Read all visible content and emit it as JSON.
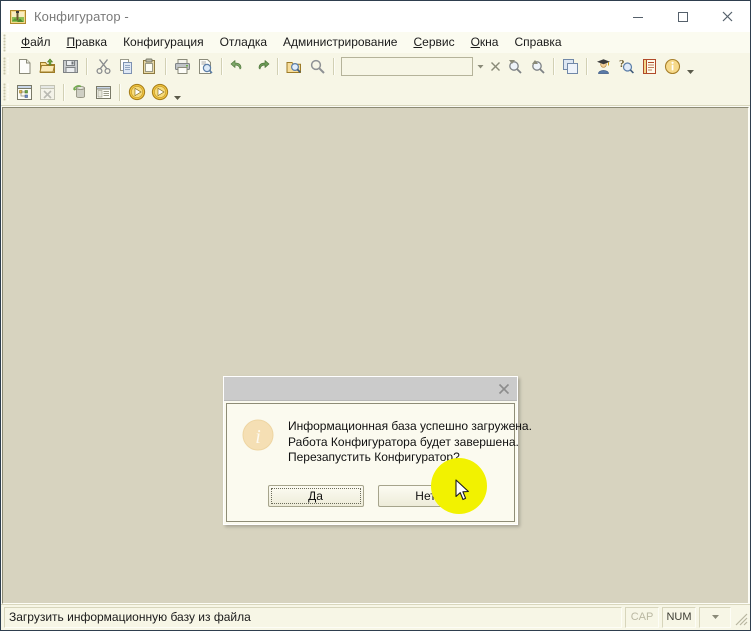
{
  "window": {
    "title": "Конфигуратор -",
    "app_icon": "configurator-icon",
    "minimize_label": "—",
    "maximize_label": "□",
    "close_label": "✕"
  },
  "menu": {
    "items": [
      {
        "label": "Файл",
        "accel": "Ф",
        "name": "menu-file"
      },
      {
        "label": "Правка",
        "accel": "П",
        "name": "menu-edit"
      },
      {
        "label": "Конфигурация",
        "accel": "",
        "name": "menu-configuration"
      },
      {
        "label": "Отладка",
        "accel": "",
        "name": "menu-debug"
      },
      {
        "label": "Администрирование",
        "accel": "",
        "name": "menu-administration"
      },
      {
        "label": "Сервис",
        "accel": "С",
        "name": "menu-service"
      },
      {
        "label": "Окна",
        "accel": "О",
        "name": "menu-windows"
      },
      {
        "label": "Справка",
        "accel": "",
        "name": "menu-help"
      }
    ]
  },
  "toolbar_main": {
    "buttons": [
      {
        "name": "new-file-icon",
        "title": "Новый"
      },
      {
        "name": "open-folder-icon",
        "title": "Открыть"
      },
      {
        "name": "save-icon",
        "title": "Сохранить"
      },
      {
        "name": "cut-icon",
        "title": "Вырезать"
      },
      {
        "name": "copy-icon",
        "title": "Копировать"
      },
      {
        "name": "paste-icon",
        "title": "Вставить"
      },
      {
        "name": "print-icon",
        "title": "Печать"
      },
      {
        "name": "print-preview-icon",
        "title": "Предварительный просмотр"
      },
      {
        "name": "undo-icon",
        "title": "Отменить"
      },
      {
        "name": "redo-icon",
        "title": "Вернуть"
      },
      {
        "name": "find-in-files-icon",
        "title": "Поиск"
      },
      {
        "name": "search-icon",
        "title": "Найти"
      }
    ],
    "combo_value": "",
    "combo_placeholder": "",
    "right_buttons": [
      {
        "name": "find-next-icon",
        "title": "Найти далее"
      },
      {
        "name": "find-previous-icon",
        "title": "Найти ранее"
      },
      {
        "name": "windows-cascade-icon",
        "title": "Окна"
      },
      {
        "name": "user-graduate-icon",
        "title": "Пользователи"
      },
      {
        "name": "help-search-icon",
        "title": "Поиск в справке"
      },
      {
        "name": "syntax-assistant-icon",
        "title": "Синтакс-помощник"
      },
      {
        "name": "about-info-icon",
        "title": "О программе"
      }
    ]
  },
  "toolbar_config": {
    "buttons": [
      {
        "name": "config-tree-icon",
        "title": "Открыть конфигурацию"
      },
      {
        "name": "config-close-icon",
        "title": "Закрыть конфигурацию"
      },
      {
        "name": "database-update-icon",
        "title": "Обновить конфигурацию базы данных"
      },
      {
        "name": "properties-window-icon",
        "title": "Свойства"
      },
      {
        "name": "start-debug-icon",
        "title": "Начать отладку"
      },
      {
        "name": "start-nodebug-icon",
        "title": "Начать сеанс"
      }
    ]
  },
  "dialog": {
    "title": "",
    "close_label": "✕",
    "icon": "information-icon",
    "message_lines": [
      "Информационная база успешно загружена.",
      "Работа Конфигуратора будет завершена.",
      "Перезапустить Конфигуратор?"
    ],
    "buttons": [
      {
        "label": "Да",
        "name": "dialog-yes-button",
        "focused": true
      },
      {
        "label": "Нет",
        "name": "dialog-no-button",
        "focused": false
      }
    ]
  },
  "status_bar": {
    "message": "Загрузить информационную базу из файла",
    "caps_label": "CAP",
    "caps_active": false,
    "num_label": "NUM",
    "num_active": true
  },
  "colors": {
    "workspace_background": "#d7d3bf",
    "toolbar_background": "#f7f6e6",
    "titlebar_background": "#ffffff",
    "dialog_titlebar": "#cbcbcb",
    "dialog_background": "#fbfaef",
    "cursor_highlight": "#f2f200",
    "window_border": "#2e3e4e"
  }
}
